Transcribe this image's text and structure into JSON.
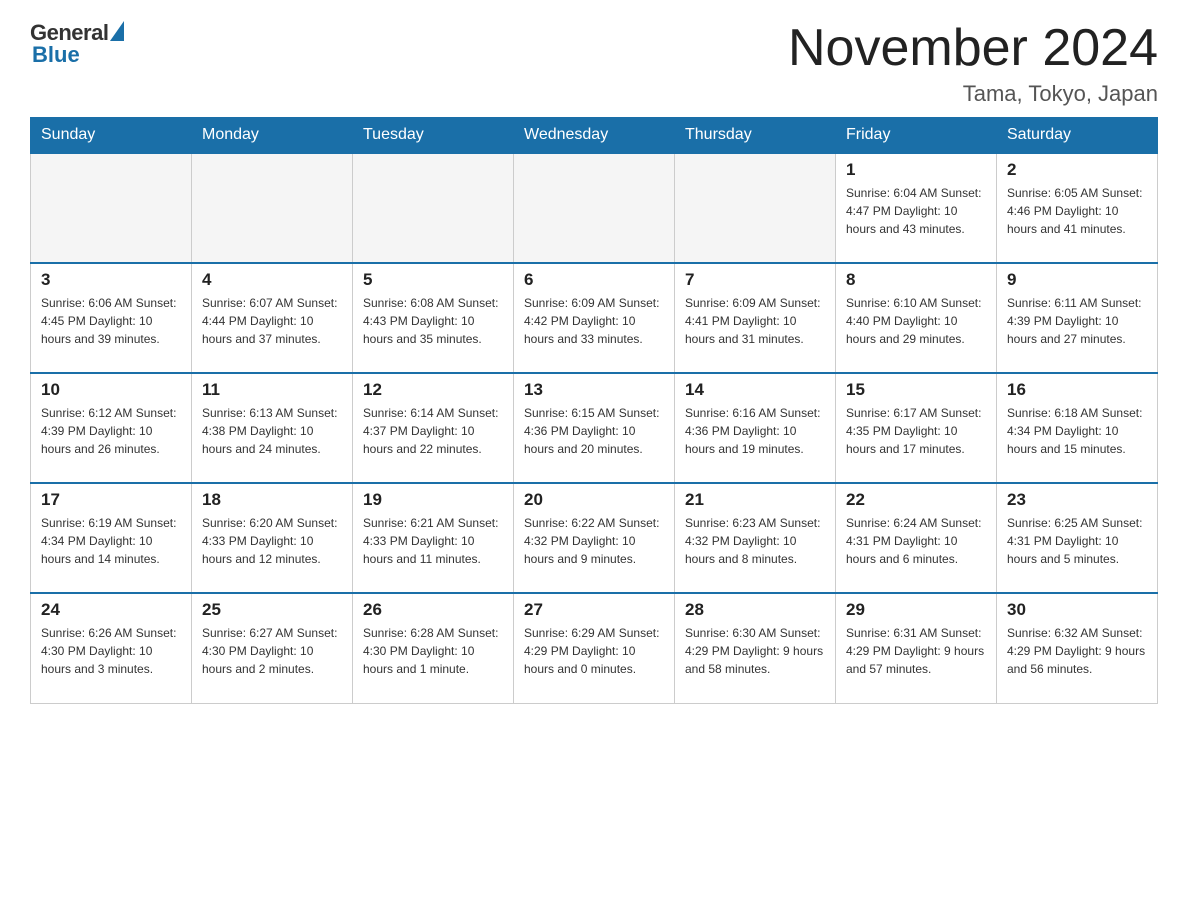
{
  "logo": {
    "general": "General",
    "blue": "Blue"
  },
  "title": "November 2024",
  "location": "Tama, Tokyo, Japan",
  "weekdays": [
    "Sunday",
    "Monday",
    "Tuesday",
    "Wednesday",
    "Thursday",
    "Friday",
    "Saturday"
  ],
  "weeks": [
    [
      {
        "day": "",
        "info": ""
      },
      {
        "day": "",
        "info": ""
      },
      {
        "day": "",
        "info": ""
      },
      {
        "day": "",
        "info": ""
      },
      {
        "day": "",
        "info": ""
      },
      {
        "day": "1",
        "info": "Sunrise: 6:04 AM\nSunset: 4:47 PM\nDaylight: 10 hours\nand 43 minutes."
      },
      {
        "day": "2",
        "info": "Sunrise: 6:05 AM\nSunset: 4:46 PM\nDaylight: 10 hours\nand 41 minutes."
      }
    ],
    [
      {
        "day": "3",
        "info": "Sunrise: 6:06 AM\nSunset: 4:45 PM\nDaylight: 10 hours\nand 39 minutes."
      },
      {
        "day": "4",
        "info": "Sunrise: 6:07 AM\nSunset: 4:44 PM\nDaylight: 10 hours\nand 37 minutes."
      },
      {
        "day": "5",
        "info": "Sunrise: 6:08 AM\nSunset: 4:43 PM\nDaylight: 10 hours\nand 35 minutes."
      },
      {
        "day": "6",
        "info": "Sunrise: 6:09 AM\nSunset: 4:42 PM\nDaylight: 10 hours\nand 33 minutes."
      },
      {
        "day": "7",
        "info": "Sunrise: 6:09 AM\nSunset: 4:41 PM\nDaylight: 10 hours\nand 31 minutes."
      },
      {
        "day": "8",
        "info": "Sunrise: 6:10 AM\nSunset: 4:40 PM\nDaylight: 10 hours\nand 29 minutes."
      },
      {
        "day": "9",
        "info": "Sunrise: 6:11 AM\nSunset: 4:39 PM\nDaylight: 10 hours\nand 27 minutes."
      }
    ],
    [
      {
        "day": "10",
        "info": "Sunrise: 6:12 AM\nSunset: 4:39 PM\nDaylight: 10 hours\nand 26 minutes."
      },
      {
        "day": "11",
        "info": "Sunrise: 6:13 AM\nSunset: 4:38 PM\nDaylight: 10 hours\nand 24 minutes."
      },
      {
        "day": "12",
        "info": "Sunrise: 6:14 AM\nSunset: 4:37 PM\nDaylight: 10 hours\nand 22 minutes."
      },
      {
        "day": "13",
        "info": "Sunrise: 6:15 AM\nSunset: 4:36 PM\nDaylight: 10 hours\nand 20 minutes."
      },
      {
        "day": "14",
        "info": "Sunrise: 6:16 AM\nSunset: 4:36 PM\nDaylight: 10 hours\nand 19 minutes."
      },
      {
        "day": "15",
        "info": "Sunrise: 6:17 AM\nSunset: 4:35 PM\nDaylight: 10 hours\nand 17 minutes."
      },
      {
        "day": "16",
        "info": "Sunrise: 6:18 AM\nSunset: 4:34 PM\nDaylight: 10 hours\nand 15 minutes."
      }
    ],
    [
      {
        "day": "17",
        "info": "Sunrise: 6:19 AM\nSunset: 4:34 PM\nDaylight: 10 hours\nand 14 minutes."
      },
      {
        "day": "18",
        "info": "Sunrise: 6:20 AM\nSunset: 4:33 PM\nDaylight: 10 hours\nand 12 minutes."
      },
      {
        "day": "19",
        "info": "Sunrise: 6:21 AM\nSunset: 4:33 PM\nDaylight: 10 hours\nand 11 minutes."
      },
      {
        "day": "20",
        "info": "Sunrise: 6:22 AM\nSunset: 4:32 PM\nDaylight: 10 hours\nand 9 minutes."
      },
      {
        "day": "21",
        "info": "Sunrise: 6:23 AM\nSunset: 4:32 PM\nDaylight: 10 hours\nand 8 minutes."
      },
      {
        "day": "22",
        "info": "Sunrise: 6:24 AM\nSunset: 4:31 PM\nDaylight: 10 hours\nand 6 minutes."
      },
      {
        "day": "23",
        "info": "Sunrise: 6:25 AM\nSunset: 4:31 PM\nDaylight: 10 hours\nand 5 minutes."
      }
    ],
    [
      {
        "day": "24",
        "info": "Sunrise: 6:26 AM\nSunset: 4:30 PM\nDaylight: 10 hours\nand 3 minutes."
      },
      {
        "day": "25",
        "info": "Sunrise: 6:27 AM\nSunset: 4:30 PM\nDaylight: 10 hours\nand 2 minutes."
      },
      {
        "day": "26",
        "info": "Sunrise: 6:28 AM\nSunset: 4:30 PM\nDaylight: 10 hours\nand 1 minute."
      },
      {
        "day": "27",
        "info": "Sunrise: 6:29 AM\nSunset: 4:29 PM\nDaylight: 10 hours\nand 0 minutes."
      },
      {
        "day": "28",
        "info": "Sunrise: 6:30 AM\nSunset: 4:29 PM\nDaylight: 9 hours\nand 58 minutes."
      },
      {
        "day": "29",
        "info": "Sunrise: 6:31 AM\nSunset: 4:29 PM\nDaylight: 9 hours\nand 57 minutes."
      },
      {
        "day": "30",
        "info": "Sunrise: 6:32 AM\nSunset: 4:29 PM\nDaylight: 9 hours\nand 56 minutes."
      }
    ]
  ]
}
